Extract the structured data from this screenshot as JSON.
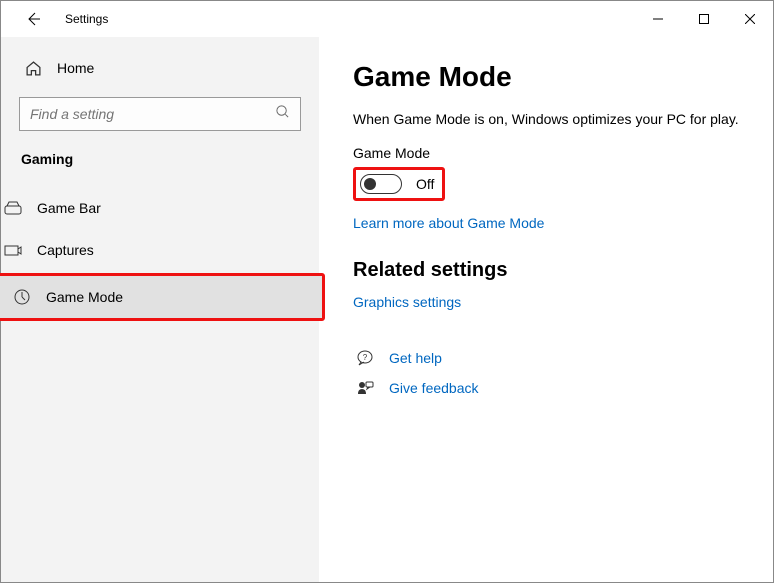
{
  "titlebar": {
    "title": "Settings"
  },
  "sidebar": {
    "home_label": "Home",
    "search_placeholder": "Find a setting",
    "category": "Gaming",
    "items": [
      {
        "label": "Game Bar"
      },
      {
        "label": "Captures"
      },
      {
        "label": "Game Mode"
      }
    ]
  },
  "main": {
    "heading": "Game Mode",
    "description": "When Game Mode is on, Windows optimizes your PC for play.",
    "toggle_label": "Game Mode",
    "toggle_state": "Off",
    "learn_more": "Learn more about Game Mode",
    "related_heading": "Related settings",
    "graphics_link": "Graphics settings",
    "get_help": "Get help",
    "give_feedback": "Give feedback"
  }
}
